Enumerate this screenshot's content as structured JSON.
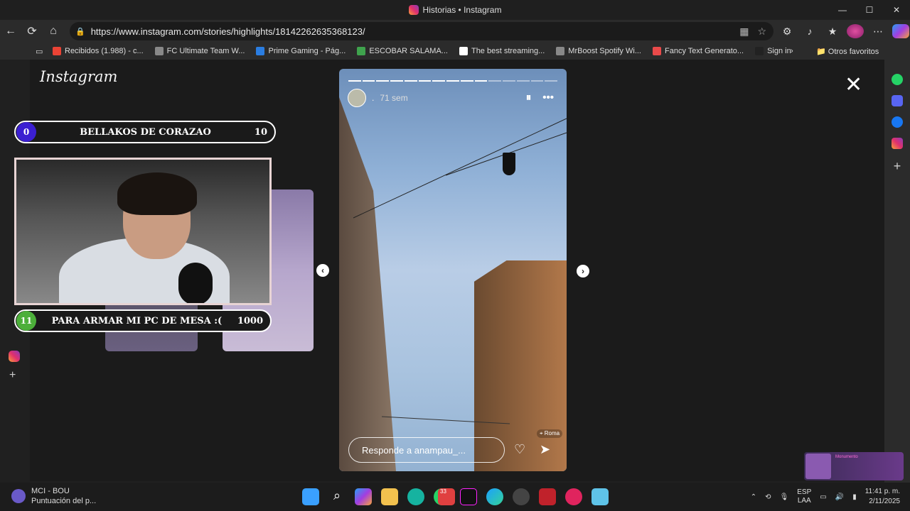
{
  "window": {
    "title": "Historias • Instagram",
    "minimize": "—",
    "maximize": "☐",
    "close": "✕"
  },
  "address": {
    "url": "https://www.instagram.com/stories/highlights/18142262635368123/"
  },
  "bookmarks": [
    {
      "label": "Recibidos (1.988) - c...",
      "color": "#ea4335"
    },
    {
      "label": "FC Ultimate Team W...",
      "color": "#888888"
    },
    {
      "label": "Prime Gaming - Pág...",
      "color": "#2a7de1"
    },
    {
      "label": "ESCOBAR SALAMA...",
      "color": "#3fa34d"
    },
    {
      "label": "The best streaming...",
      "color": "#ffffff"
    },
    {
      "label": "MrBoost Spotify Wi...",
      "color": "#888888"
    },
    {
      "label": "Fancy Text Generato...",
      "color": "#e94a4a"
    },
    {
      "label": "Sign in",
      "color": "#222222"
    }
  ],
  "other_favorites": "Otros favoritos",
  "page": {
    "logo": "Instagram",
    "close": "✕"
  },
  "story": {
    "progress_total": 15,
    "progress_done": 10,
    "username": ".",
    "time": "71 sem",
    "pause": "⏸",
    "more": "•••",
    "location": "Roma",
    "reply_placeholder": "Responde a anampau_...",
    "like": "♡",
    "share": "➤"
  },
  "nav": {
    "prev": "‹",
    "next": "›"
  },
  "overlay": {
    "top_bar": {
      "left": "0",
      "title": "BELLAKOS DE CORAZAO",
      "right": "10",
      "circle_color": "#3b1fd1"
    },
    "bottom_bar": {
      "left": "11",
      "title": "PARA ARMAR MI PC DE MESA :(",
      "right": "1000",
      "circle_color": "#4caf3a"
    }
  },
  "music": {
    "title": "Monumento"
  },
  "taskbar": {
    "weather_title": "MCI - BOU",
    "weather_sub": "Puntuación del p...",
    "whatsapp_badge": "33",
    "lang": "ESP",
    "lang_sub": "LAA",
    "time": "11:41 p. m.",
    "date": "2/11/2025"
  }
}
